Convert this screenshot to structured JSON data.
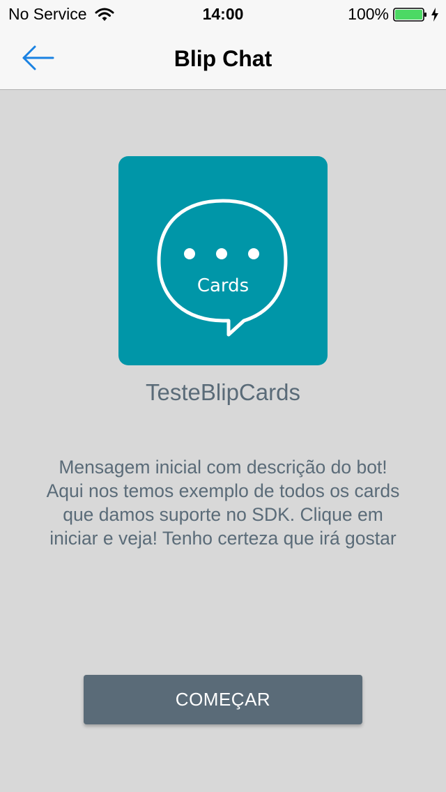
{
  "status_bar": {
    "carrier": "No Service",
    "time": "14:00",
    "battery_percent": "100%",
    "battery_level": 1.0,
    "icons": [
      "wifi-icon",
      "battery-icon",
      "charging-icon"
    ]
  },
  "nav": {
    "title": "Blip Chat",
    "back_icon": "arrow-left-icon"
  },
  "bot": {
    "avatar_label": "Cards",
    "name": "TesteBlipCards",
    "description": "Mensagem inicial com descrição do bot! Aqui nos temos exemplo de todos os cards que damos suporte no SDK. Clique em iniciar e veja! Tenho certeza que irá gostar"
  },
  "actions": {
    "start_label": "COMEÇAR"
  },
  "colors": {
    "background": "#d8d8d8",
    "bar_background": "#f7f7f7",
    "accent_blue": "#1a82e2",
    "avatar_teal": "#0096a8",
    "text_slate": "#5a6b78",
    "button_slate": "#5a6b78",
    "battery_green": "#4cd964"
  }
}
